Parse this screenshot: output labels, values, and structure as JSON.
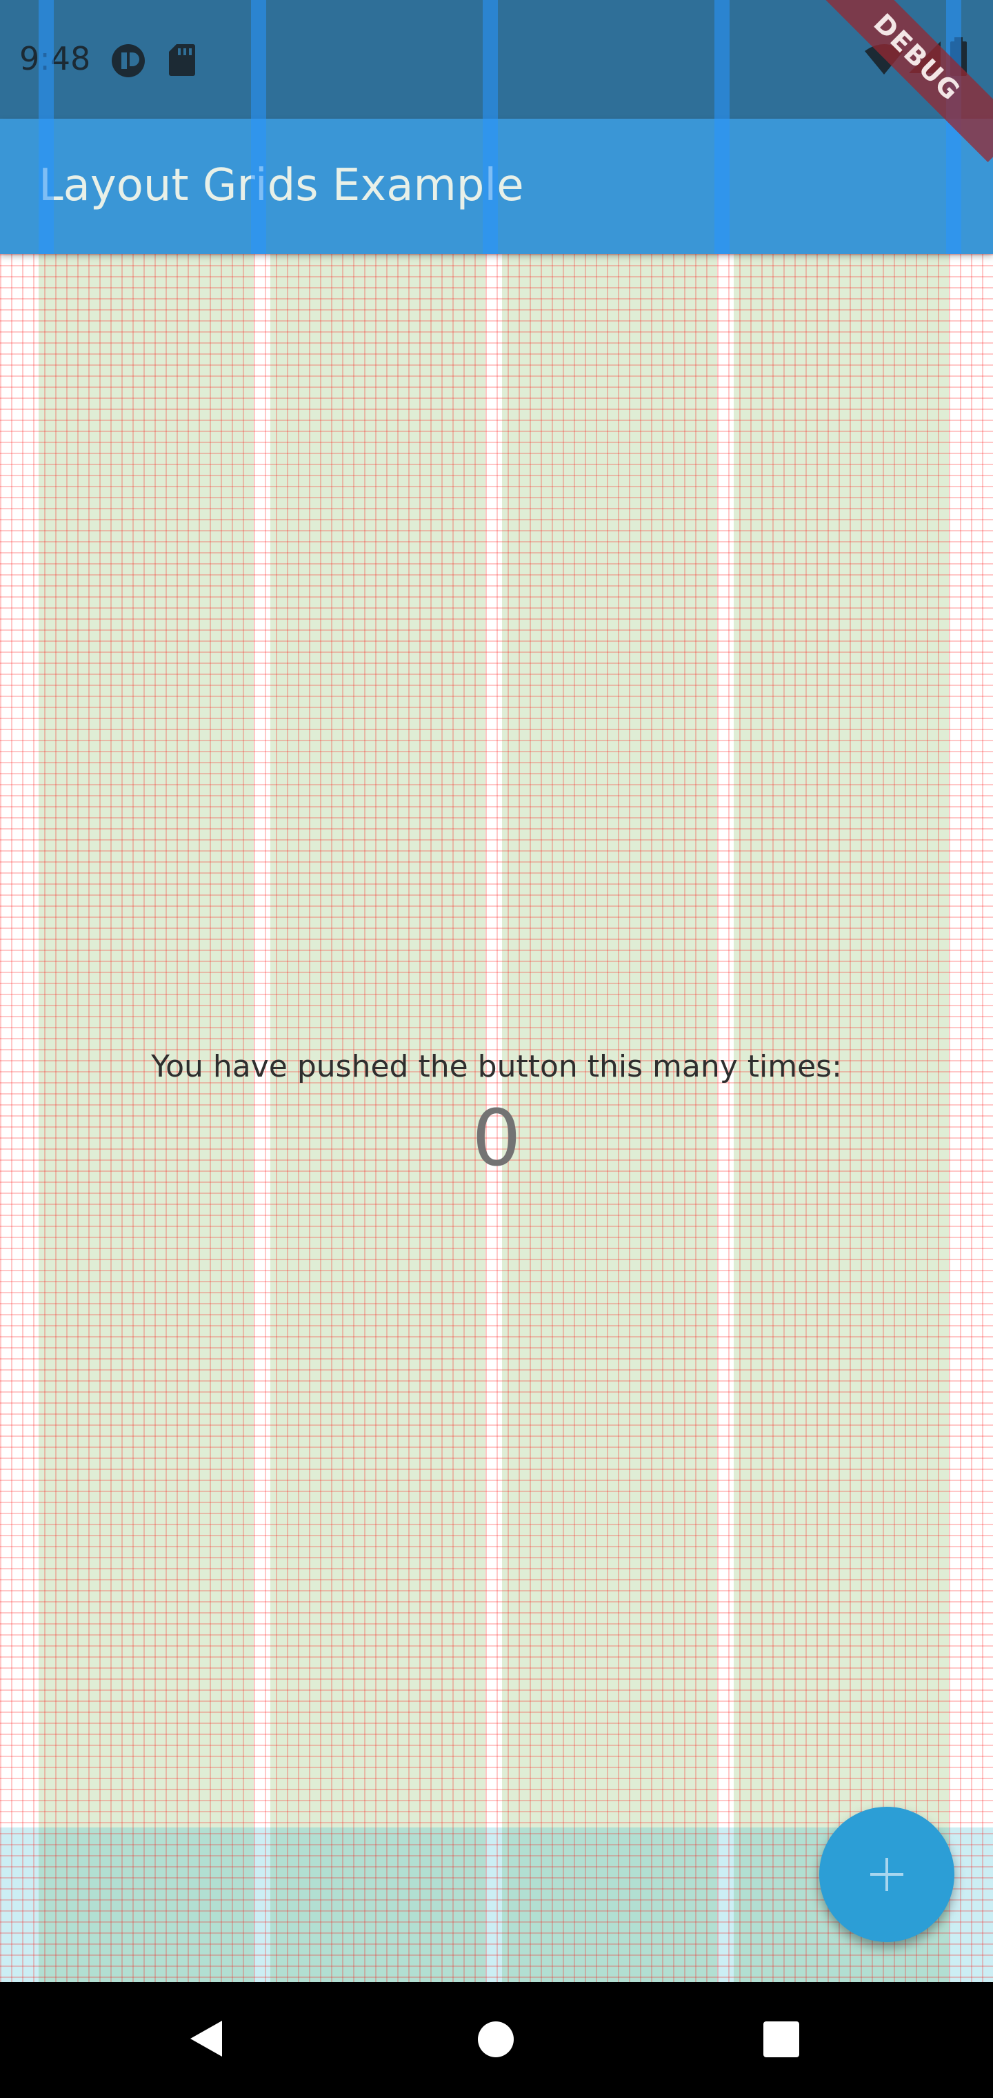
{
  "status_bar": {
    "time": "9:48",
    "left_icons": [
      "app-indicator-icon",
      "sd-card-icon"
    ],
    "right_icons": [
      "wifi-icon",
      "signal-icon",
      "battery-icon"
    ]
  },
  "debug_banner": {
    "label": "DEBUG"
  },
  "app_bar": {
    "title": "Layout Grids Example"
  },
  "main": {
    "message": "You have pushed the button this many times:",
    "counter": "0"
  },
  "fab": {
    "icon": "add-icon"
  },
  "nav_bar": {
    "icons": [
      "back-icon",
      "home-icon",
      "recents-icon"
    ]
  },
  "colors": {
    "status_bar": "#2f6f98",
    "app_bar": "#3a96d6",
    "fab": "#2c9ed6",
    "grid_line": "#ff0000",
    "column_fill": "#7ab450",
    "row_band_fill": "#00aac8"
  }
}
